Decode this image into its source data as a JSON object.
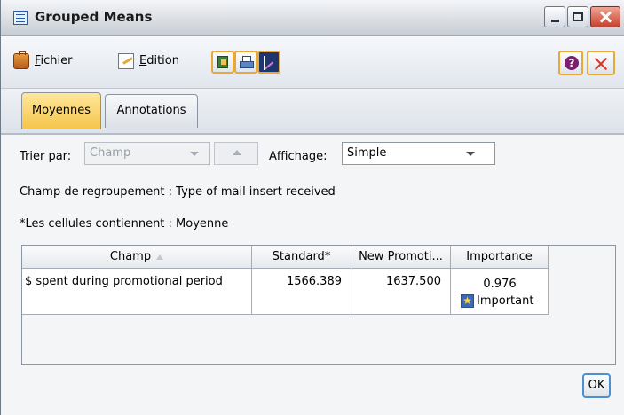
{
  "window": {
    "title": "Grouped Means"
  },
  "toolbar": {
    "file_label": "Fichier",
    "file_mnemonic": "F",
    "file_rest": "ichier",
    "edit_label": "Edition",
    "edit_mnemonic": "E",
    "edit_rest": "dition"
  },
  "tabs": [
    {
      "label": "Moyennes",
      "active": true
    },
    {
      "label": "Annotations",
      "active": false
    }
  ],
  "controls": {
    "sort_label": "Trier par:",
    "sort_value": "Champ",
    "view_label": "Affichage:",
    "view_value": "Simple"
  },
  "info": {
    "grouping": "Champ de regroupement : Type of mail insert received",
    "cells": "*Les cellules contiennent : Moyenne"
  },
  "table": {
    "headers": [
      "Champ",
      "Standard*",
      "New Promoti...",
      "Importance"
    ],
    "rows": [
      {
        "champ": "$ spent during promotional period",
        "standard": "1566.389",
        "new_promotion": "1637.500",
        "importance_value": "0.976",
        "importance_label": "Important"
      }
    ]
  },
  "buttons": {
    "ok": "OK"
  },
  "colors": {
    "active_tab": "#f5c44a",
    "close_button": "#c8412f",
    "accent_border": "#e6a93a",
    "ok_border": "#4f8fd1"
  }
}
